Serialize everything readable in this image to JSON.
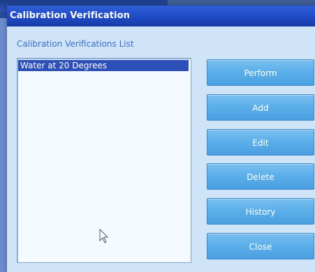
{
  "dialog": {
    "title": "Calibration Verification",
    "list_label": "Calibration Verifications List",
    "list_items": [
      {
        "label": "Water at 20 Degrees",
        "selected": true
      }
    ]
  },
  "buttons": {
    "perform": "Perform",
    "add": "Add",
    "edit": "Edit",
    "delete": "Delete",
    "history": "History",
    "close": "Close"
  },
  "colors": {
    "titlebar": "#1f4ac5",
    "dialog_background": "#cfe4f7",
    "button": "#5aaee9",
    "selection": "#2d4fb8",
    "label_text": "#3a6fd0"
  }
}
